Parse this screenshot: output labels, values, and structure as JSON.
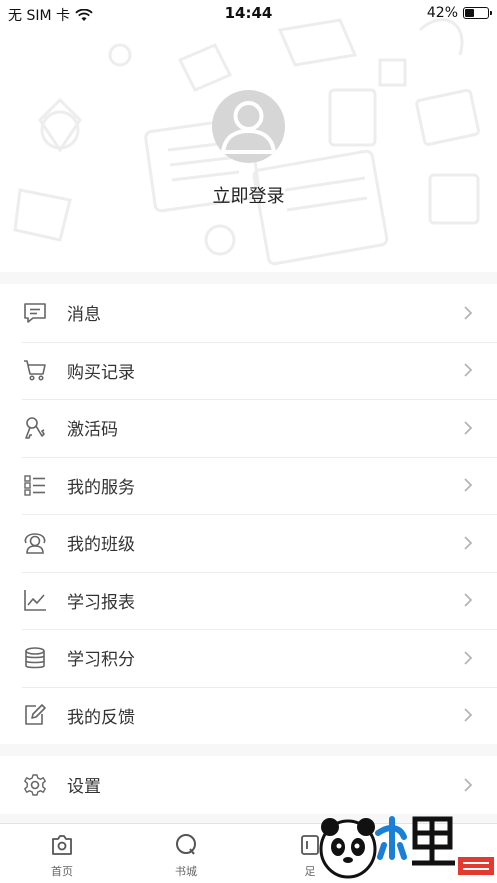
{
  "status_bar": {
    "carrier": "无 SIM 卡",
    "time": "14:44",
    "battery_percent": "42%",
    "battery_level": 0.42
  },
  "profile": {
    "login_label": "立即登录"
  },
  "menu_main": [
    {
      "label": "消息",
      "icon": "message-icon"
    },
    {
      "label": "购买记录",
      "icon": "cart-icon"
    },
    {
      "label": "激活码",
      "icon": "key-icon"
    },
    {
      "label": "我的服务",
      "icon": "service-list-icon"
    },
    {
      "label": "我的班级",
      "icon": "class-icon"
    },
    {
      "label": "学习报表",
      "icon": "chart-line-icon"
    },
    {
      "label": "学习积分",
      "icon": "coins-stack-icon"
    },
    {
      "label": "我的反馈",
      "icon": "edit-icon"
    }
  ],
  "menu_settings": [
    {
      "label": "设置",
      "icon": "gear-icon"
    }
  ],
  "tabbar": {
    "tabs": [
      {
        "label": "首页",
        "icon": "home-icon"
      },
      {
        "label": "书城",
        "icon": "search-circle-icon"
      },
      {
        "label": "足",
        "icon": "footprint-icon"
      }
    ]
  },
  "colors": {
    "background": "#f7f7f7",
    "text": "#333333",
    "icon": "#666666",
    "avatar": "#d6d6d6",
    "divider": "#ececec"
  }
}
